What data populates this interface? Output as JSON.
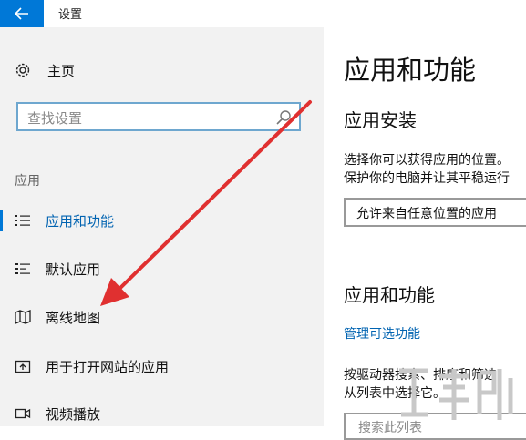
{
  "window": {
    "title": "设置"
  },
  "sidebar": {
    "home_label": "主页",
    "search_placeholder": "查找设置",
    "section_label": "应用",
    "items": [
      {
        "label": "应用和功能",
        "icon": "list-icon",
        "active": true
      },
      {
        "label": "默认应用",
        "icon": "default-apps-icon",
        "active": false
      },
      {
        "label": "离线地图",
        "icon": "map-icon",
        "active": false
      },
      {
        "label": "用于打开网站的应用",
        "icon": "open-website-icon",
        "active": false
      },
      {
        "label": "视频播放",
        "icon": "video-icon",
        "active": false
      }
    ]
  },
  "main": {
    "title": "应用和功能",
    "install_heading": "应用安装",
    "install_desc_line1": "选择你可以获得应用的位置。",
    "install_desc_line2": "保护你的电脑并让其平稳运行",
    "install_dropdown_value": "允许来自任意位置的应用",
    "apps_heading": "应用和功能",
    "optional_features_link": "管理可选功能",
    "apps_desc_line1": "按驱动器搜索、排序和筛选。",
    "apps_desc_line2": "从列表中选择它。",
    "apps_search_placeholder": "搜索此列表"
  },
  "colors": {
    "accent": "#0078d7",
    "link": "#0063b1",
    "annotation_arrow": "#e03030"
  }
}
